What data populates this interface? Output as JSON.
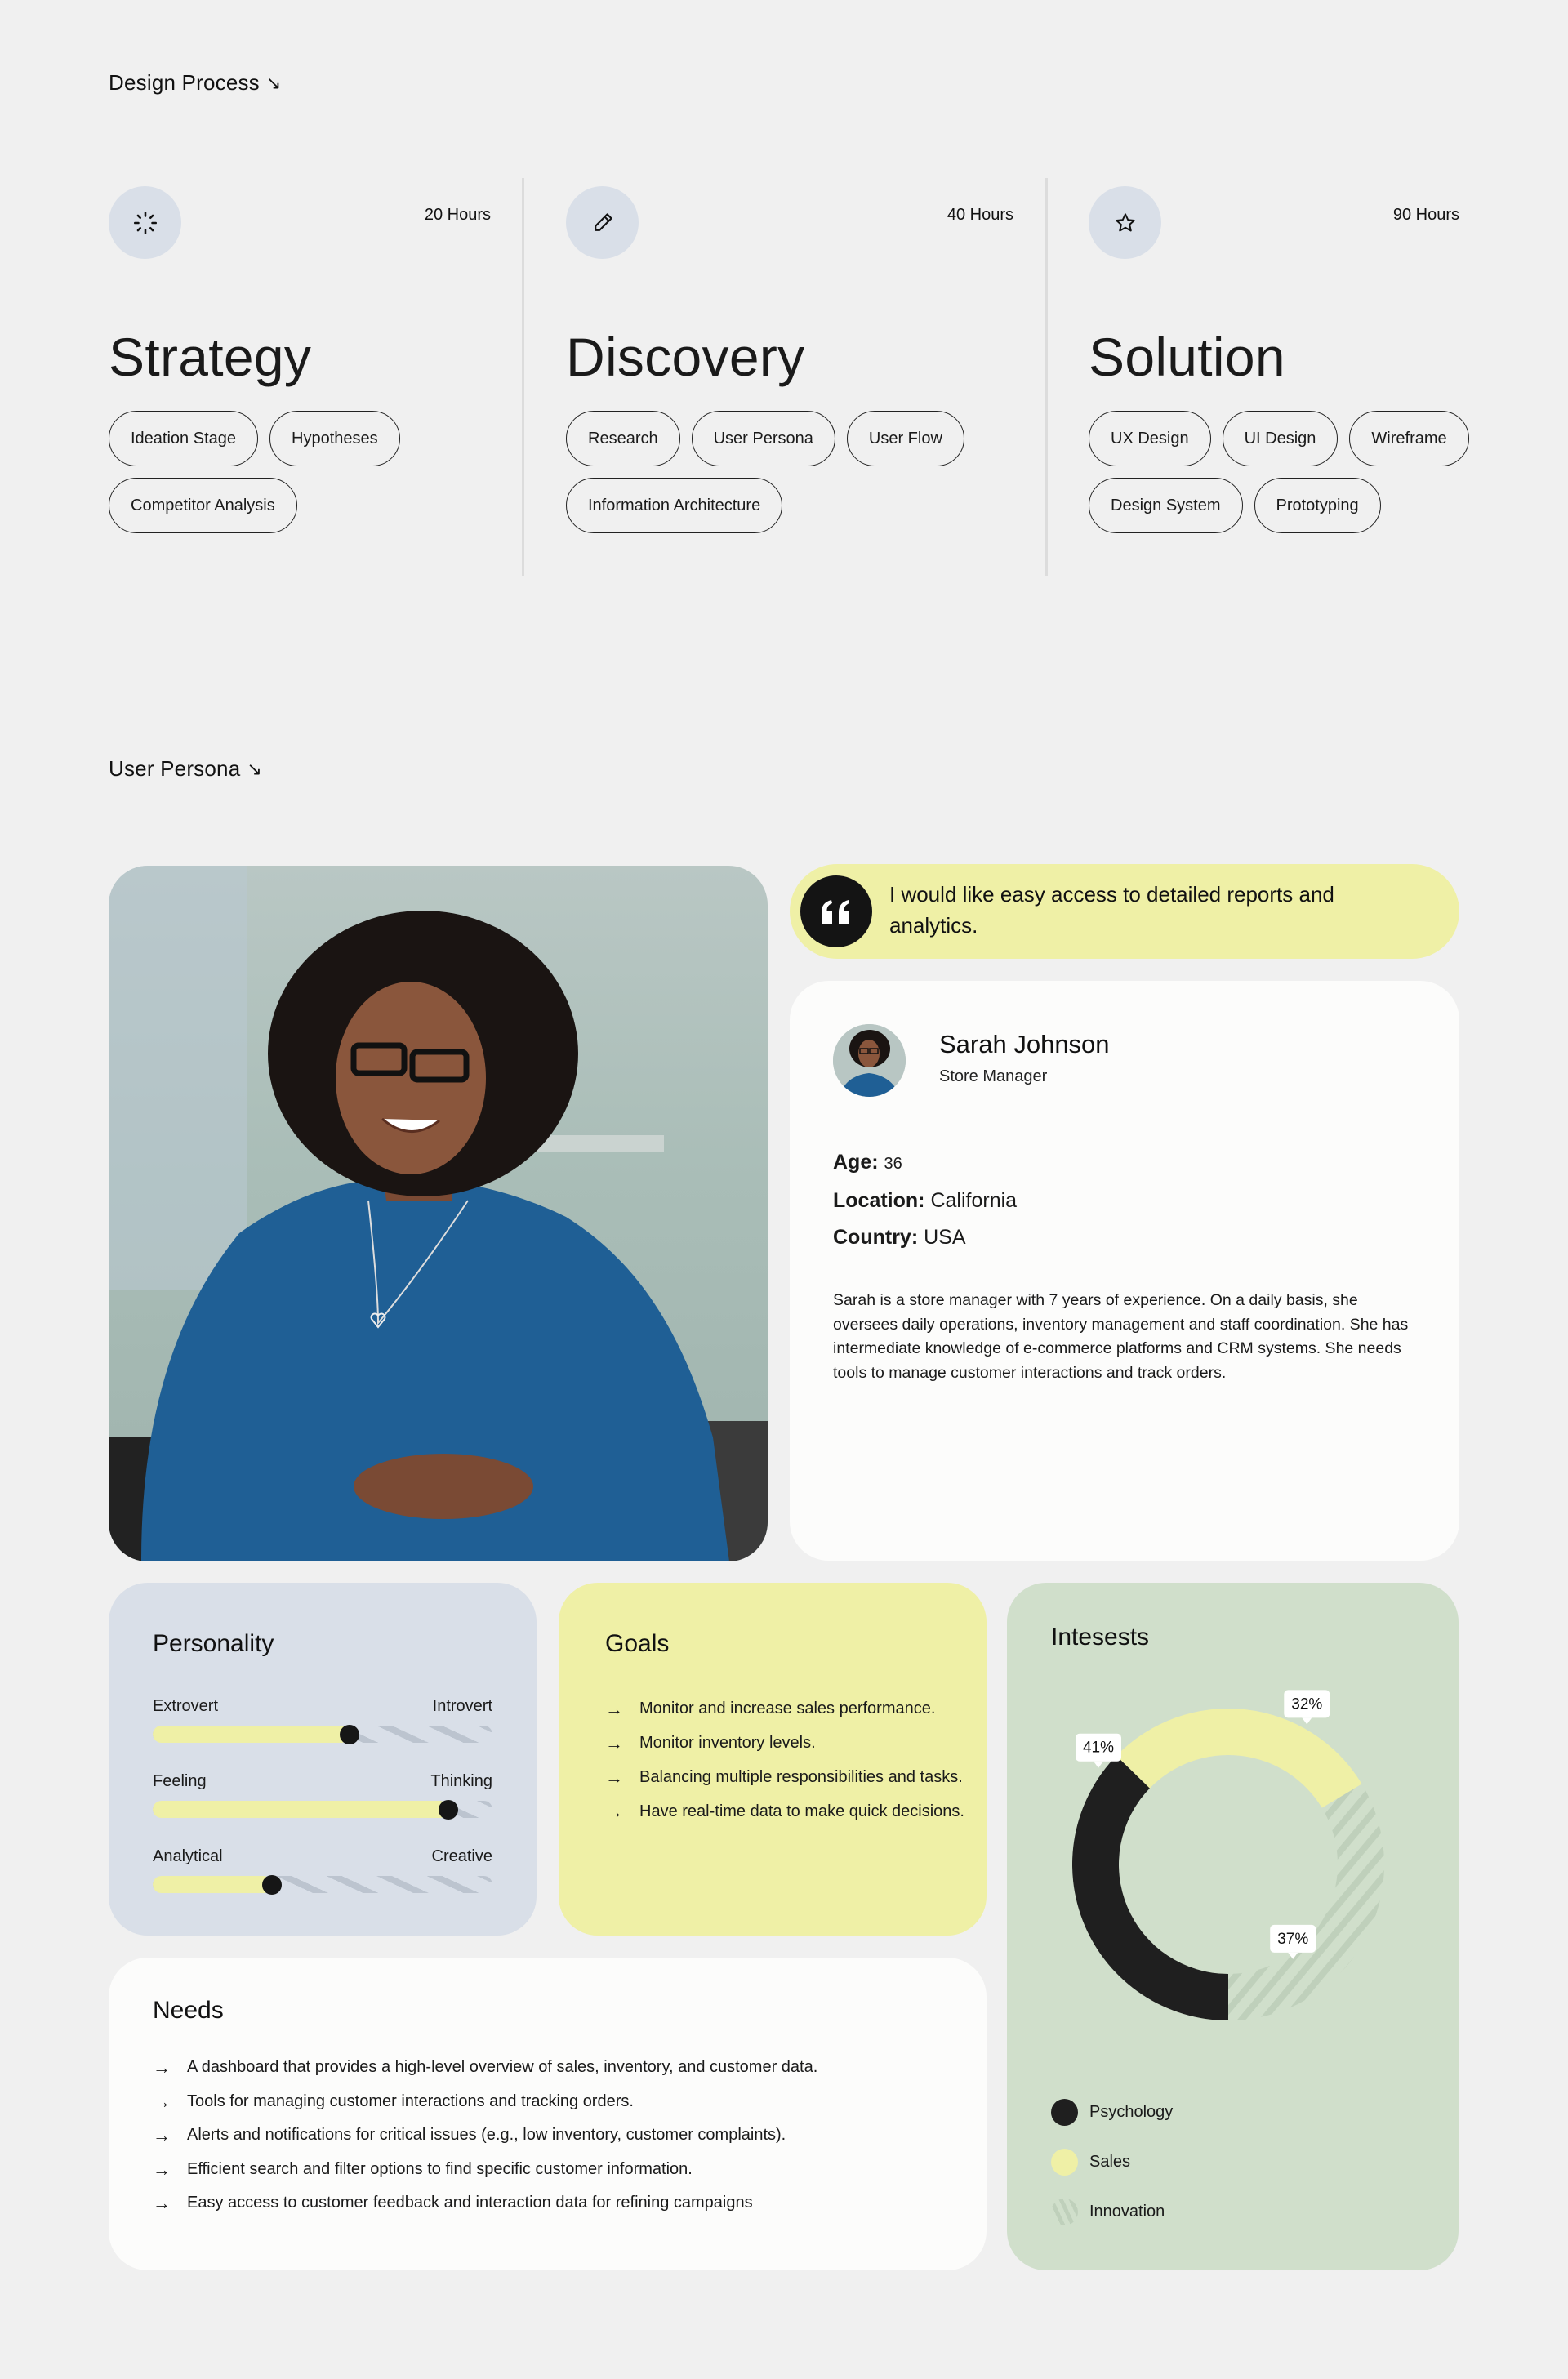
{
  "design_process": {
    "label": "Design Process",
    "arrow": "↘",
    "stages": [
      {
        "icon": "loader-icon",
        "hours": "20 Hours",
        "title": "Strategy",
        "tags": [
          "Ideation Stage",
          "Hypotheses",
          "Competitor Analysis"
        ]
      },
      {
        "icon": "pencil-icon",
        "hours": "40 Hours",
        "title": "Discovery",
        "tags": [
          "Research",
          "User Persona",
          "User Flow",
          "Information Architecture"
        ]
      },
      {
        "icon": "star-icon",
        "hours": "90 Hours",
        "title": "Solution",
        "tags": [
          "UX Design",
          "UI Design",
          "Wireframe",
          "Design System",
          "Prototyping"
        ]
      }
    ]
  },
  "user_persona": {
    "label": "User Persona",
    "arrow": "↘",
    "quote": "I would like easy access to detailed reports and analytics.",
    "profile": {
      "name": "Sarah Johnson",
      "role": "Store Manager",
      "age_label": "Age:",
      "age": "36",
      "location_label": "Location:",
      "location": "California",
      "country_label": "Country:",
      "country": "USA",
      "bio": "Sarah is a store manager with 7 years of experience. On a daily basis, she oversees daily operations, inventory management and staff coordination. She has intermediate knowledge of e-commerce platforms and CRM systems. She needs tools to manage customer interactions and track orders."
    },
    "personality": {
      "title": "Personality",
      "traits": [
        {
          "left": "Extrovert",
          "right": "Introvert",
          "value": 0.58
        },
        {
          "left": "Feeling",
          "right": "Thinking",
          "value": 0.87
        },
        {
          "left": "Analytical",
          "right": "Creative",
          "value": 0.35
        }
      ]
    },
    "goals": {
      "title": "Goals",
      "items": [
        "Monitor and increase sales performance.",
        "Monitor inventory levels.",
        "Balancing multiple responsibilities and tasks.",
        "Have real-time data to make quick decisions."
      ]
    },
    "needs": {
      "title": "Needs",
      "items": [
        "A dashboard that provides a high-level overview of sales, inventory, and customer data.",
        "Tools for managing customer interactions and tracking orders.",
        "Alerts and notifications for critical issues (e.g., low inventory, customer complaints).",
        "Efficient search and filter options to find specific customer information.",
        "Easy access to customer feedback and interaction data for refining campaigns"
      ]
    },
    "interests": {
      "title": "Intesests"
    }
  },
  "colors": {
    "background": "#f0f0f0",
    "accent_yellow": "#eff0a6",
    "accent_blue_gray": "#d9dfe8",
    "accent_green": "#d0dfcb",
    "dark": "#1f1f1f"
  },
  "chart_data": {
    "type": "pie",
    "variant": "donut",
    "title": "Intesests",
    "categories": [
      "Psychology",
      "Sales",
      "Innovation"
    ],
    "values": [
      41,
      32,
      37
    ],
    "labels": [
      "41%",
      "32%",
      "37%"
    ],
    "colors": [
      "#1f1f1f",
      "#eff0a6",
      "hatched"
    ],
    "legend": "bottom-left"
  }
}
